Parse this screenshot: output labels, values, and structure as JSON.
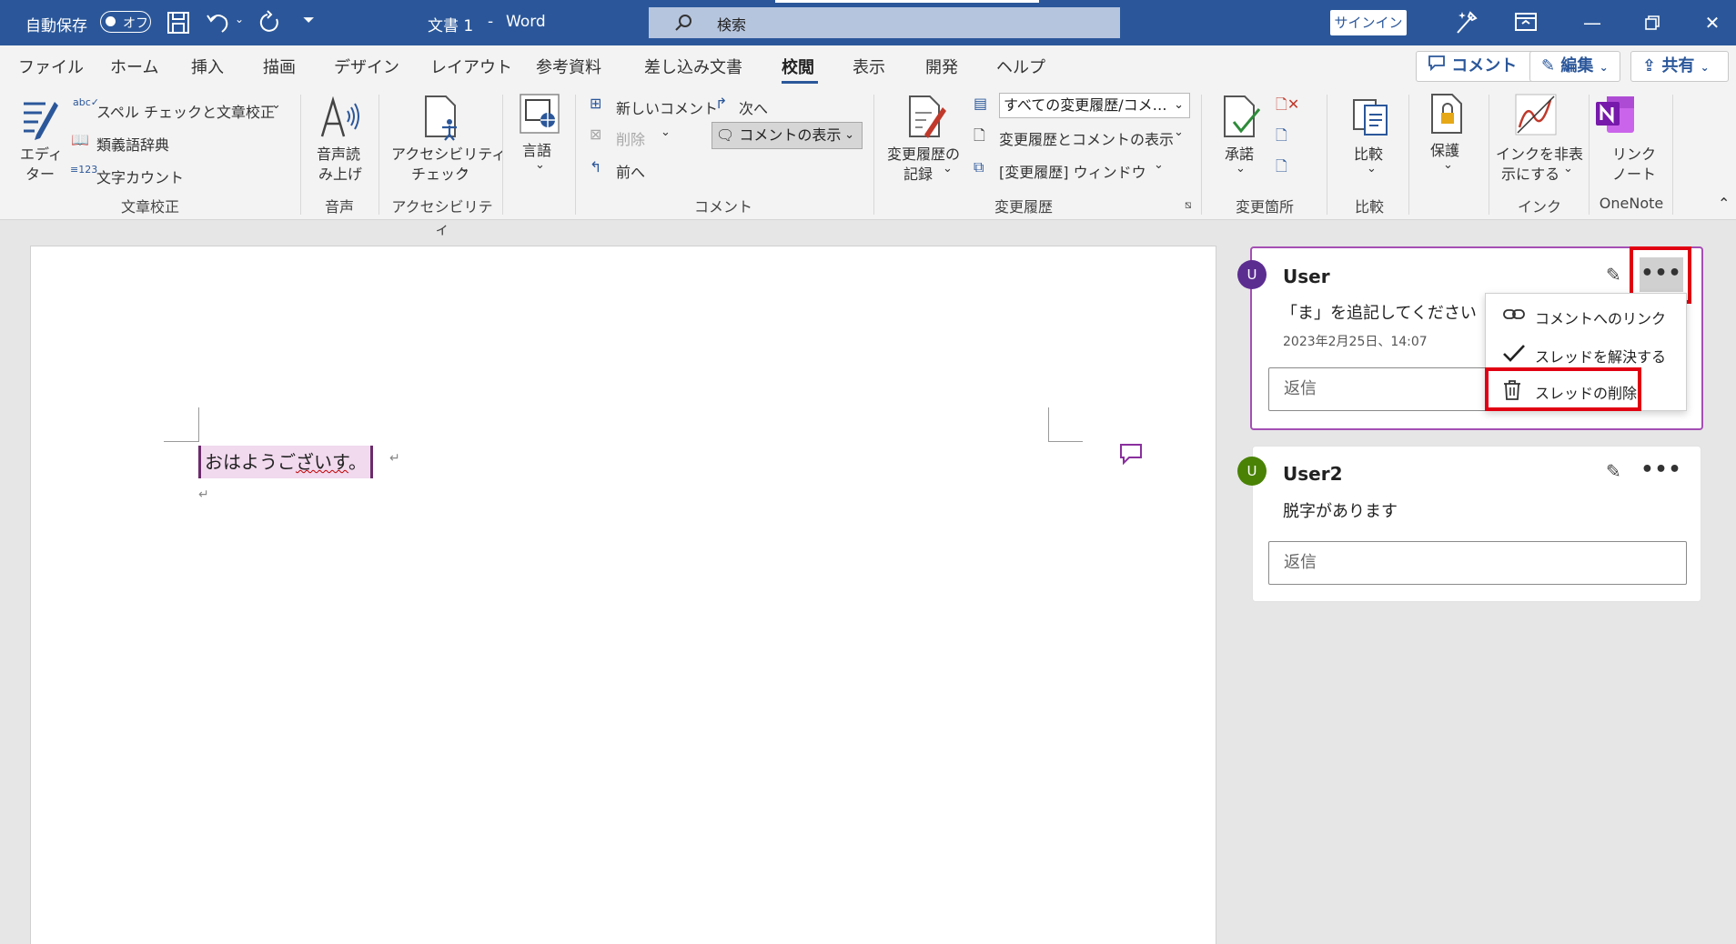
{
  "titlebar": {
    "autosave_label": "自動保存",
    "autosave_state": "オフ",
    "doc_title": "文書 1",
    "title_sep": "-",
    "app_name": "Word",
    "search_placeholder": "検索",
    "signin_label": "サインイン",
    "accent_color": "#2b579a"
  },
  "menu": {
    "tabs": [
      "ファイル",
      "ホーム",
      "挿入",
      "描画",
      "デザイン",
      "レイアウト",
      "参考資料",
      "差し込み文書",
      "校閲",
      "表示",
      "開発",
      "ヘルプ"
    ],
    "active_tab": "校閲",
    "comment_button": "コメント",
    "edit_button": "編集",
    "share_button": "共有"
  },
  "ribbon": {
    "proofing": {
      "editor_line1": "エディ",
      "editor_line2": "ター",
      "spelling": "スペル チェックと文章校正",
      "thesaurus": "類義語辞典",
      "word_count": "文字カウント",
      "group": "文章校正"
    },
    "speech": {
      "read_aloud_line1": "音声読",
      "read_aloud_line2": "み上げ",
      "group": "音声"
    },
    "accessibility": {
      "check_line1": "アクセシビリティ",
      "check_line2": "チェック",
      "group": "アクセシビリティ"
    },
    "language": {
      "label": "言語"
    },
    "comments": {
      "new": "新しいコメント",
      "delete": "削除",
      "previous": "前へ",
      "next": "次へ",
      "show": "コメントの表示",
      "group": "コメント"
    },
    "tracking": {
      "track_line1": "変更履歴の",
      "track_line2": "記録",
      "markup_select": "すべての変更履歴/コメ…",
      "show_markup": "変更履歴とコメントの表示",
      "reviewing_pane": "[変更履歴] ウィンドウ",
      "group": "変更履歴"
    },
    "changes": {
      "accept": "承諾",
      "group": "変更箇所"
    },
    "compare": {
      "label": "比較",
      "group": "比較"
    },
    "protect": {
      "label": "保護"
    },
    "ink": {
      "hide_line1": "インクを非表",
      "hide_line2": "示にする",
      "group": "インク"
    },
    "onenote": {
      "link_line1": "リンク",
      "link_line2": "ノート",
      "group": "OneNote"
    }
  },
  "document": {
    "text_plain1": "おはようご",
    "text_squiggle": "ざいす",
    "text_plain2": "。",
    "para_mark": "↵"
  },
  "comments": [
    {
      "avatar": "U",
      "avatar_color": "#5c2d91",
      "user": "User",
      "body": "「ま」を追記してください",
      "date": "2023年2月25日、14:07",
      "reply_placeholder": "返信"
    },
    {
      "avatar": "U",
      "avatar_color": "#498205",
      "user": "User2",
      "body": "脱字があります",
      "reply_placeholder": "返信"
    }
  ],
  "context_menu": {
    "link": "コメントへのリンク",
    "resolve": "スレッドを解決する",
    "delete": "スレッドの削除"
  },
  "highlight_color": "#e00012"
}
